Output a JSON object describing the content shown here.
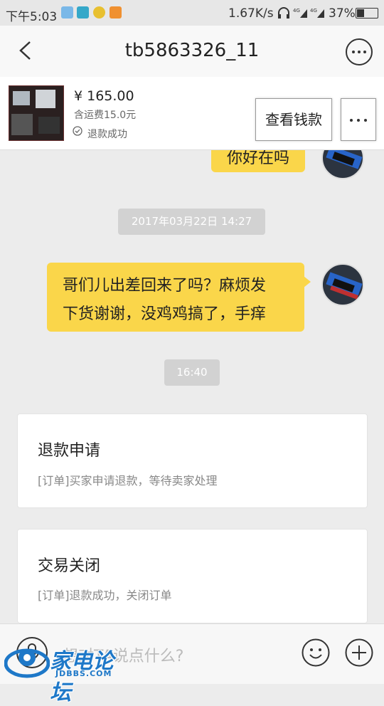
{
  "status_bar": {
    "time": "下午5:03",
    "network_speed": "1.67K/s",
    "battery": "37%"
  },
  "nav": {
    "title": "tb5863326_11"
  },
  "order": {
    "price": "¥ 165.00",
    "shipping": "含运费15.0元",
    "refund_status": "退款成功",
    "view_money_label": "查看钱款"
  },
  "chat": {
    "partial_message": "你好在吗",
    "timestamp_1": "2017年03月22日 14:27",
    "message_line_1": "哥们儿出差回来了吗？麻烦发",
    "message_line_2": "下货谢谢，没鸡鸡搞了，手痒",
    "timestamp_2": "16:40",
    "card_1": {
      "title": "退款申请",
      "desc": "[订单]买家申请退款，等待卖家处理"
    },
    "card_2": {
      "title": "交易关闭",
      "desc": "[订单]退款成功，关闭订单"
    }
  },
  "input": {
    "placeholder": "想对TA说点什么?"
  },
  "watermark": {
    "text": "家电论坛",
    "sub": "JDBBS.COM"
  },
  "colors": {
    "bubble": "#fad64a",
    "background": "#ececec"
  }
}
